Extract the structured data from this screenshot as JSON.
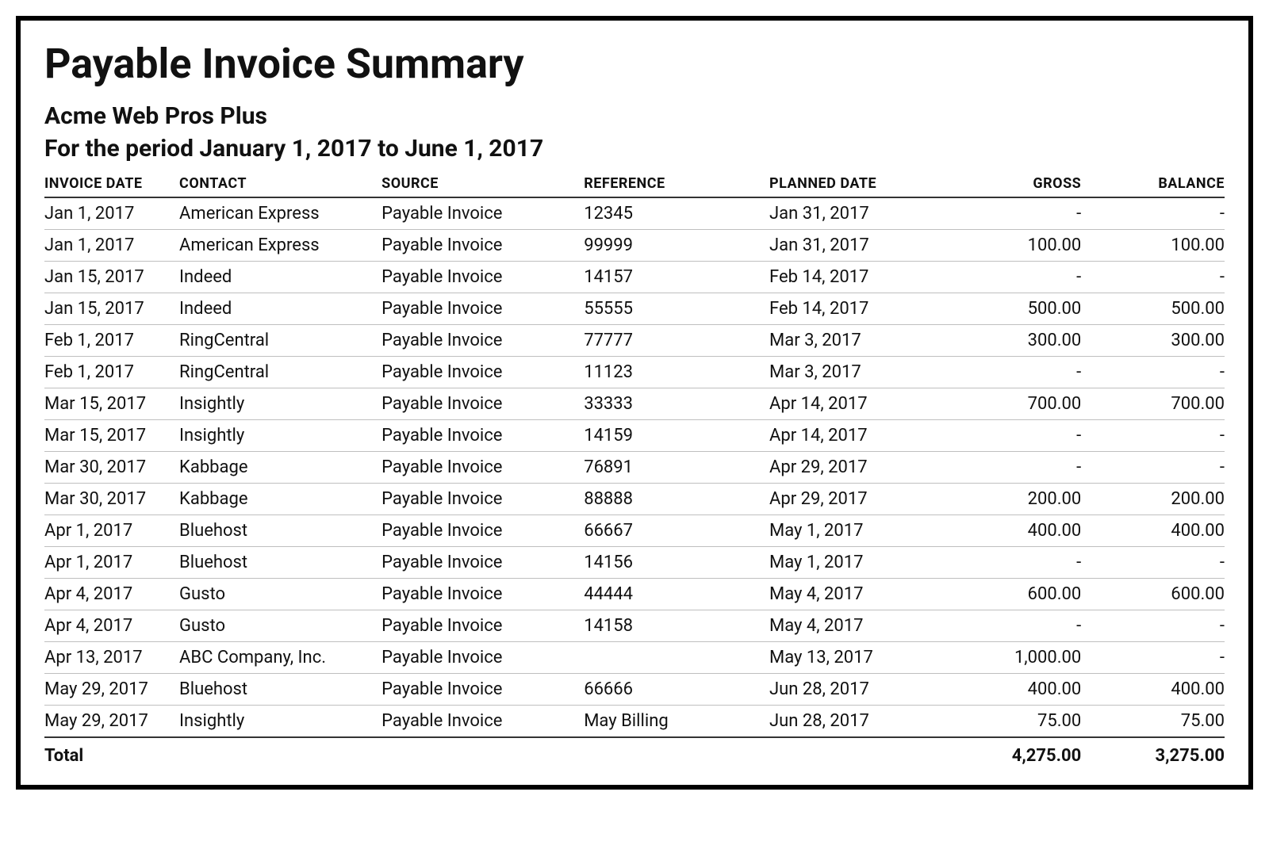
{
  "report": {
    "title": "Payable Invoice Summary",
    "company": "Acme Web Pros Plus",
    "period": "For the period January 1, 2017 to June 1, 2017"
  },
  "columns": {
    "invoice_date": "INVOICE DATE",
    "contact": "CONTACT",
    "source": "SOURCE",
    "reference": "REFERENCE",
    "planned_date": "PLANNED DATE",
    "gross": "GROSS",
    "balance": "BALANCE"
  },
  "rows": [
    {
      "invoice_date": "Jan 1, 2017",
      "contact": "American Express",
      "source": "Payable Invoice",
      "reference": "12345",
      "planned_date": "Jan 31, 2017",
      "gross": "-",
      "balance": "-"
    },
    {
      "invoice_date": "Jan 1, 2017",
      "contact": "American Express",
      "source": "Payable Invoice",
      "reference": "99999",
      "planned_date": "Jan 31, 2017",
      "gross": "100.00",
      "balance": "100.00"
    },
    {
      "invoice_date": "Jan 15, 2017",
      "contact": "Indeed",
      "source": "Payable Invoice",
      "reference": "14157",
      "planned_date": "Feb 14, 2017",
      "gross": "-",
      "balance": "-"
    },
    {
      "invoice_date": "Jan 15, 2017",
      "contact": "Indeed",
      "source": "Payable Invoice",
      "reference": "55555",
      "planned_date": "Feb 14, 2017",
      "gross": "500.00",
      "balance": "500.00"
    },
    {
      "invoice_date": "Feb 1, 2017",
      "contact": "RingCentral",
      "source": "Payable Invoice",
      "reference": "77777",
      "planned_date": "Mar 3, 2017",
      "gross": "300.00",
      "balance": "300.00"
    },
    {
      "invoice_date": "Feb 1, 2017",
      "contact": "RingCentral",
      "source": "Payable Invoice",
      "reference": "11123",
      "planned_date": "Mar 3, 2017",
      "gross": "-",
      "balance": "-"
    },
    {
      "invoice_date": "Mar 15, 2017",
      "contact": "Insightly",
      "source": "Payable Invoice",
      "reference": "33333",
      "planned_date": "Apr 14, 2017",
      "gross": "700.00",
      "balance": "700.00"
    },
    {
      "invoice_date": "Mar 15, 2017",
      "contact": "Insightly",
      "source": "Payable Invoice",
      "reference": "14159",
      "planned_date": "Apr 14, 2017",
      "gross": "-",
      "balance": "-"
    },
    {
      "invoice_date": "Mar 30, 2017",
      "contact": "Kabbage",
      "source": "Payable Invoice",
      "reference": "76891",
      "planned_date": "Apr 29, 2017",
      "gross": "-",
      "balance": "-"
    },
    {
      "invoice_date": "Mar 30, 2017",
      "contact": "Kabbage",
      "source": "Payable Invoice",
      "reference": "88888",
      "planned_date": "Apr 29, 2017",
      "gross": "200.00",
      "balance": "200.00"
    },
    {
      "invoice_date": "Apr 1, 2017",
      "contact": "Bluehost",
      "source": "Payable Invoice",
      "reference": "66667",
      "planned_date": "May 1, 2017",
      "gross": "400.00",
      "balance": "400.00"
    },
    {
      "invoice_date": "Apr 1, 2017",
      "contact": "Bluehost",
      "source": "Payable Invoice",
      "reference": "14156",
      "planned_date": "May 1, 2017",
      "gross": "-",
      "balance": "-"
    },
    {
      "invoice_date": "Apr 4, 2017",
      "contact": "Gusto",
      "source": "Payable Invoice",
      "reference": "44444",
      "planned_date": "May 4, 2017",
      "gross": "600.00",
      "balance": "600.00"
    },
    {
      "invoice_date": "Apr 4, 2017",
      "contact": "Gusto",
      "source": "Payable Invoice",
      "reference": "14158",
      "planned_date": "May 4, 2017",
      "gross": "-",
      "balance": "-"
    },
    {
      "invoice_date": "Apr 13, 2017",
      "contact": "ABC Company, Inc.",
      "source": "Payable Invoice",
      "reference": "",
      "planned_date": "May 13, 2017",
      "gross": "1,000.00",
      "balance": "-"
    },
    {
      "invoice_date": "May 29, 2017",
      "contact": "Bluehost",
      "source": "Payable Invoice",
      "reference": "66666",
      "planned_date": "Jun 28, 2017",
      "gross": "400.00",
      "balance": "400.00"
    },
    {
      "invoice_date": "May 29, 2017",
      "contact": "Insightly",
      "source": "Payable Invoice",
      "reference": "May Billing",
      "planned_date": "Jun 28, 2017",
      "gross": "75.00",
      "balance": "75.00"
    }
  ],
  "totals": {
    "label": "Total",
    "gross": "4,275.00",
    "balance": "3,275.00"
  }
}
